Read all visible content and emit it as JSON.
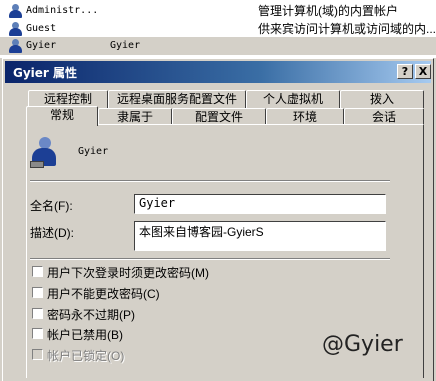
{
  "user_list": [
    {
      "name": "Administr...",
      "fullname": "",
      "description": "管理计算机(域)的内置帐户",
      "selected": false
    },
    {
      "name": "Guest",
      "fullname": "",
      "description": "供来宾访问计算机或访问域的内...",
      "selected": false
    },
    {
      "name": "Gyier",
      "fullname": "Gyier",
      "description": "",
      "selected": true
    }
  ],
  "dialog": {
    "title": "Gyier 属性",
    "help_button": "?",
    "close_button": "X",
    "tabs_row1": [
      "远程控制",
      "远程桌面服务配置文件",
      "个人虚拟机",
      "拨入"
    ],
    "tabs_row2": [
      "常规",
      "隶属于",
      "配置文件",
      "环境",
      "会话"
    ],
    "active_tab": "常规",
    "user_display_name": "Gyier",
    "fullname_label": "全名(F):",
    "fullname_value": "Gyier",
    "description_label": "描述(D):",
    "description_value": "本图来自博客园-GyierS",
    "checkboxes": [
      {
        "label": "用户下次登录时须更改密码(M)",
        "checked": false,
        "enabled": true
      },
      {
        "label": "用户不能更改密码(C)",
        "checked": false,
        "enabled": true
      },
      {
        "label": "密码永不过期(P)",
        "checked": false,
        "enabled": true
      },
      {
        "label": "帐户已禁用(B)",
        "checked": false,
        "enabled": true
      },
      {
        "label": "帐户已锁定(O)",
        "checked": false,
        "enabled": false
      }
    ]
  },
  "watermark": "@Gyier",
  "colors": {
    "titlebar_start": "#0a246a",
    "titlebar_end": "#a6caf0",
    "face": "#d4d0c8"
  }
}
